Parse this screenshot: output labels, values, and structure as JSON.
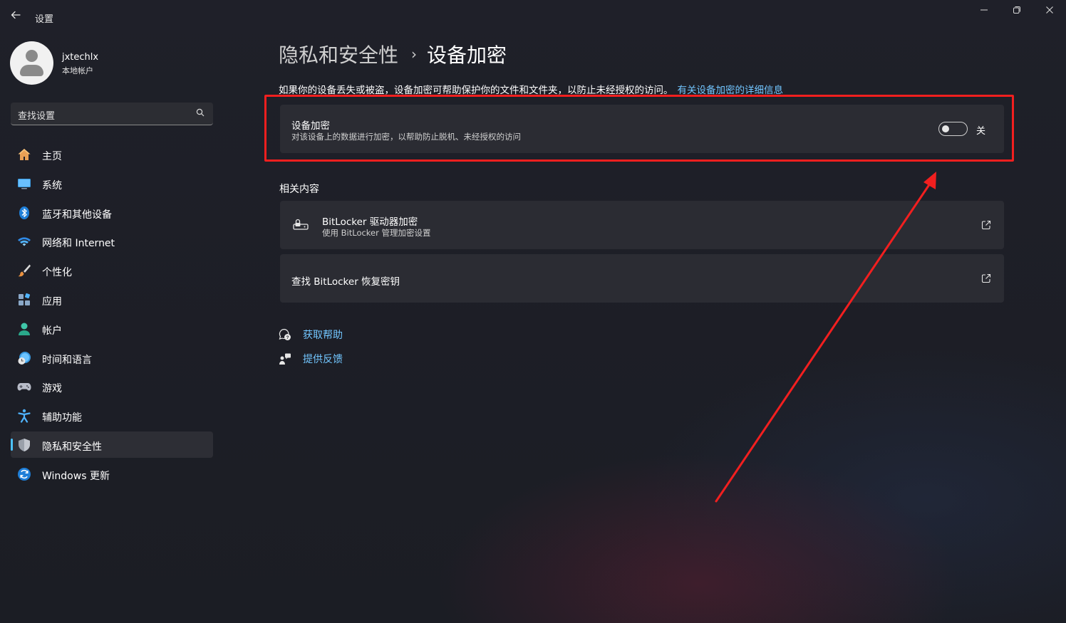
{
  "window": {
    "title": "设置",
    "back_icon": "back-arrow-icon",
    "controls": [
      "minimize-icon",
      "maximize-icon",
      "close-icon"
    ]
  },
  "profile": {
    "name": "jxtechlx",
    "account_type": "本地帐户"
  },
  "search": {
    "placeholder": "查找设置",
    "icon": "search-icon"
  },
  "sidebar": {
    "items": [
      {
        "label": "主页",
        "icon": "home-icon",
        "color": "#f0b060",
        "active": false
      },
      {
        "label": "系统",
        "icon": "system-icon",
        "color": "#4fa8e8",
        "active": false
      },
      {
        "label": "蓝牙和其他设备",
        "icon": "bluetooth-icon",
        "color": "#2f8ae6",
        "active": false
      },
      {
        "label": "网络和 Internet",
        "icon": "wifi-icon",
        "color": "#4fb4ff",
        "active": false
      },
      {
        "label": "个性化",
        "icon": "brush-icon",
        "color": "#e8a060",
        "active": false
      },
      {
        "label": "应用",
        "icon": "apps-icon",
        "color": "#8aa8c8",
        "active": false
      },
      {
        "label": "帐户",
        "icon": "account-icon",
        "color": "#3fc6a8",
        "active": false
      },
      {
        "label": "时间和语言",
        "icon": "time-language-icon",
        "color": "#4fb4ff",
        "active": false
      },
      {
        "label": "游戏",
        "icon": "gaming-icon",
        "color": "#b8bcc8",
        "active": false
      },
      {
        "label": "辅助功能",
        "icon": "accessibility-icon",
        "color": "#4fb4ff",
        "active": false
      },
      {
        "label": "隐私和安全性",
        "icon": "shield-icon",
        "color": "#9aa0aa",
        "active": true
      },
      {
        "label": "Windows 更新",
        "icon": "windows-update-icon",
        "color": "#2f8ae6",
        "active": false
      }
    ]
  },
  "main": {
    "breadcrumb_parent": "隐私和安全性",
    "breadcrumb_separator": "›",
    "page_title": "设备加密",
    "intro": "如果你的设备丢失或被盗，设备加密可帮助保护你的文件和文件夹，以防止未经授权的访问。",
    "intro_link": "有关设备加密的详细信息",
    "encryption_card": {
      "title": "设备加密",
      "subtitle": "对该设备上的数据进行加密，以帮助防止脱机、未经授权的访问",
      "toggle_state": "关",
      "toggle_on": false
    },
    "related_title": "相关内容",
    "bitlocker_card": {
      "title": "BitLocker 驱动器加密",
      "subtitle": "使用 BitLocker 管理加密设置",
      "icon": "bitlocker-icon",
      "action_icon": "open-external-icon"
    },
    "recovery_card": {
      "title": "查找 BitLocker 恢复密钥",
      "action_icon": "open-external-icon"
    },
    "help": {
      "get_help": "获取帮助",
      "feedback": "提供反馈"
    }
  },
  "colors": {
    "accent": "#4cc2ff",
    "link": "#72c6ff",
    "annotation": "#f21f1f",
    "card": "#2b2c33",
    "background": "#1d1f26"
  }
}
